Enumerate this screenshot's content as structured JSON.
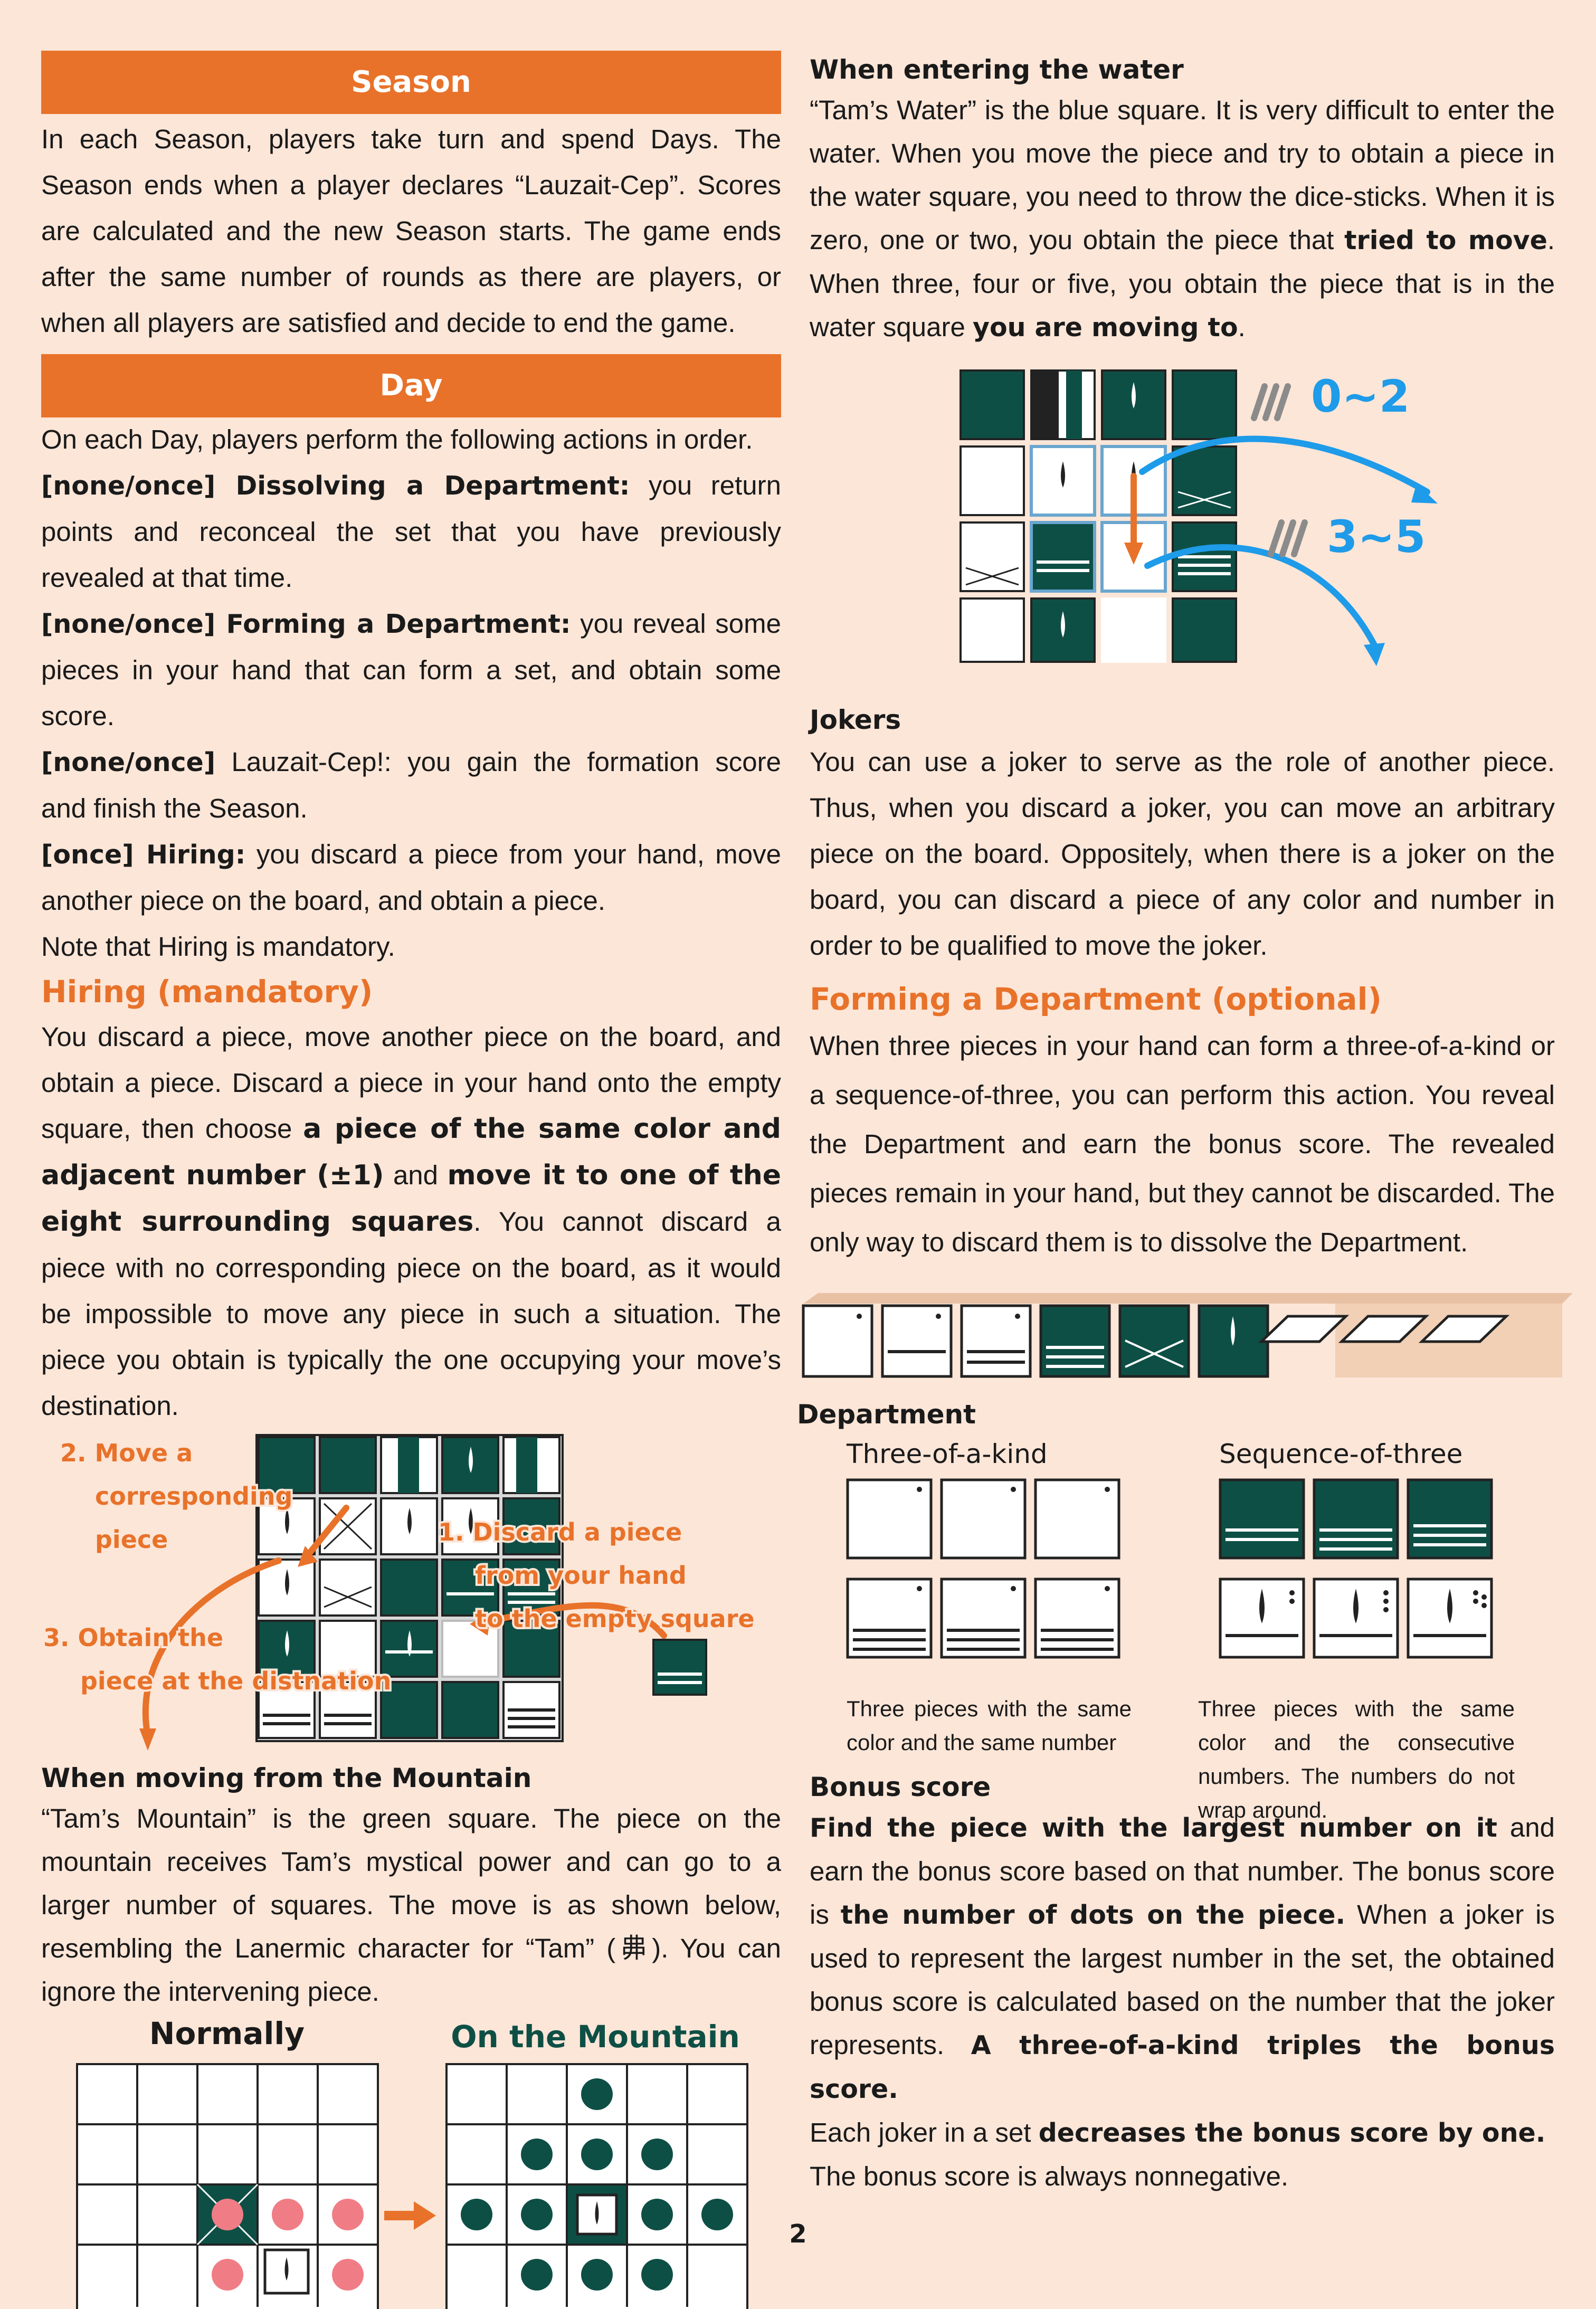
{
  "season": {
    "title": "Season",
    "text": "In each Season, players take turn and spend Days. The Season ends when a player declares “Lauzait-Cep”. Scores are calculated and the new Season starts. The game ends after the same number of rounds as there are players, or when all players are satisfied and decide to end the game."
  },
  "day": {
    "title": "Day",
    "intro": "On each Day, players perform the following actions in order.",
    "a1_bold": "[none/once] Dissolving a Department:",
    "a1_text": " you return points and reconceal the set that you have previously revealed at that time.",
    "a2_bold": "[none/once] Forming a Department:",
    "a2_text": " you reveal some pieces in your hand that can form a set, and obtain some score.",
    "a3_bold": "[none/once]",
    "a3_text": " Lauzait-Cep!: you gain the formation score and finish the Season.",
    "a4_bold": "[once] Hiring:",
    "a4_text": " you discard a piece from your hand, move another piece on the board, and obtain a piece.",
    "note": "Note that Hiring is mandatory."
  },
  "hiring": {
    "title": "Hiring (mandatory)",
    "t1": "You discard a piece, move another piece on the board, and obtain a piece. Discard a piece in your hand onto the empty square, then choose ",
    "b1": "a piece of the same color and adjacent number (±1)",
    "t2": " and ",
    "b2": "move it to one of the eight surrounding squares",
    "t3": ". You cannot discard a piece with no corresponding piece on the board, as it would be impossible to move any piece in such a situation. The piece you obtain is typically the one occupying your move’s destination.",
    "fig_label_move": [
      "2. Move a",
      "corresponding",
      "piece"
    ],
    "fig_label_discard": [
      "1. Discard a piece",
      "from your hand",
      "to the empty square"
    ],
    "fig_label_obtain": [
      "3. Obtain the",
      "piece at the distnation"
    ]
  },
  "mountain": {
    "title": "When moving from the Mountain",
    "text": "“Tam’s Mountain” is the green square. The piece on the mountain receives Tam’s mystical power and can go to a larger number of squares. The move is as shown below, resembling the Lanermic character for “Tam” (丳). You can ignore the intervening piece.",
    "label_normal": "Normally",
    "label_mountain": "On the Mountain"
  },
  "water": {
    "title": "When entering the water",
    "t1": "“Tam’s Water” is the blue square. It is very difficult to enter the water. When you move the piece and try to obtain a piece in the water square, you need to throw the dice-sticks. When it is zero, one or two, you obtain the piece that ",
    "b1": "tried to move",
    "t2": ". When three, four or five, you obtain the piece that is in the water square ",
    "b2": "you are moving to",
    "t3": ".",
    "label_low": "0~2",
    "label_high": "3~5"
  },
  "jokers": {
    "title": "Jokers",
    "text": "You can use a joker to serve as the role of another piece. Thus, when you discard a joker, you can move an arbitrary piece on the board. Oppositely, when there is a joker on the board, you can discard a piece of any color and number in order to be qualified to move the joker."
  },
  "forming": {
    "title": "Forming a Department (optional)",
    "text": "When three pieces in your hand can form a three-of-a-kind or a sequence-of-three, you can perform this action. You reveal the Department and earn the bonus score. The revealed pieces remain in your hand, but they cannot be discarded. The only way to discard them is to dissolve the Department."
  },
  "department": {
    "title": "Department",
    "kind_label": "Three-of-a-kind",
    "seq_label": "Sequence-of-three",
    "kind_caption": "Three pieces with the same color and the same number",
    "seq_caption": "Three pieces with the same color and the consecutive numbers. The numbers do not wrap around."
  },
  "bonus": {
    "title": "Bonus score",
    "b1": "Find the piece with the largest number on it",
    "t1": " and earn the bonus score based on that number. The bonus score is ",
    "b2": "the number of dots on the piece.",
    "t2": " When a joker is used to represent the largest number in the set, the obtained bonus score is calculated based on the number that the joker represents. ",
    "b3": "A three-of-a-kind triples the bonus score.",
    "t3": "Each joker in a set ",
    "b4": "decreases the bonus score by one.",
    "t4": "The bonus score is always nonnegative."
  },
  "page_number": "2",
  "colors": {
    "orange": "#e8722a",
    "green": "#0e4f45",
    "blue": "#1e9be9",
    "pink": "#f07d85",
    "background": "#fce6d8"
  }
}
